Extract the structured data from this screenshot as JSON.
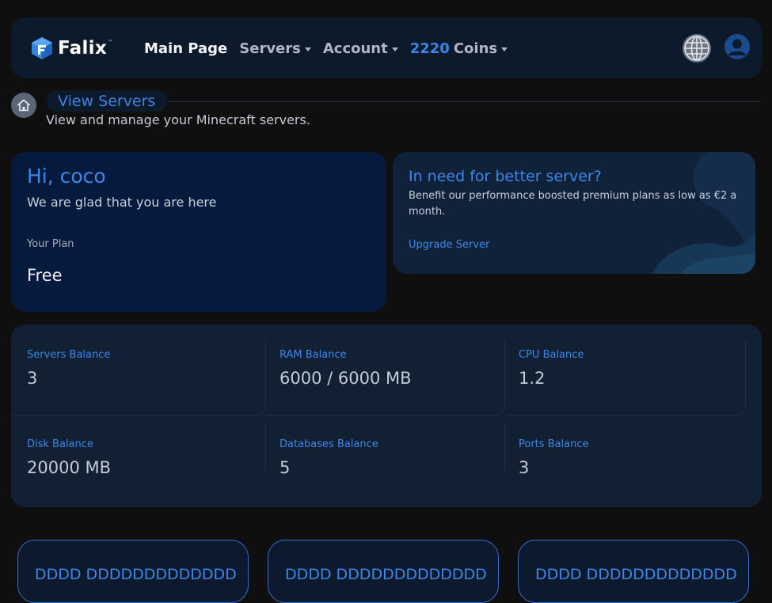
{
  "brand": {
    "name": "Falix",
    "tm": "™"
  },
  "nav": {
    "items": [
      {
        "label": "Main Page",
        "dropdown": false,
        "active": true
      },
      {
        "label": "Servers",
        "dropdown": true
      },
      {
        "label": "Account",
        "dropdown": true
      }
    ],
    "coins": {
      "amount": "2220",
      "label": "Coins"
    }
  },
  "icons": {
    "language": "globe-icon",
    "user": "user-avatar-icon",
    "home": "home-icon"
  },
  "breadcrumb": {
    "title": "View Servers",
    "subtitle": "View and manage your Minecraft servers."
  },
  "welcome": {
    "greeting": "Hi, coco",
    "message": "We are glad that you are here",
    "plan_label": "Your Plan",
    "plan_value": "Free"
  },
  "promo": {
    "title": "In need for better server?",
    "description": "Benefit our performance boosted premium plans as low as €2 a month.",
    "link": "Upgrade Server"
  },
  "balances": {
    "servers": {
      "label": "Servers Balance",
      "value": "3"
    },
    "ram": {
      "label": "RAM Balance",
      "value": "6000 / 6000 MB"
    },
    "cpu": {
      "label": "CPU Balance",
      "value": "1.2"
    },
    "disk": {
      "label": "Disk Balance",
      "value": "20000 MB"
    },
    "databases": {
      "label": "Databases Balance",
      "value": "5"
    },
    "ports": {
      "label": "Ports Balance",
      "value": "3"
    }
  },
  "server_cards": [
    {
      "title": "DDDD DDDDDDDDDDDDD"
    },
    {
      "title": "DDDD DDDDDDDDDDDDD"
    },
    {
      "title": "DDDD DDDDDDDDDDDDD"
    }
  ],
  "colors": {
    "accent": "#3d86ea",
    "background": "#0f0f10",
    "card": "#112033"
  }
}
